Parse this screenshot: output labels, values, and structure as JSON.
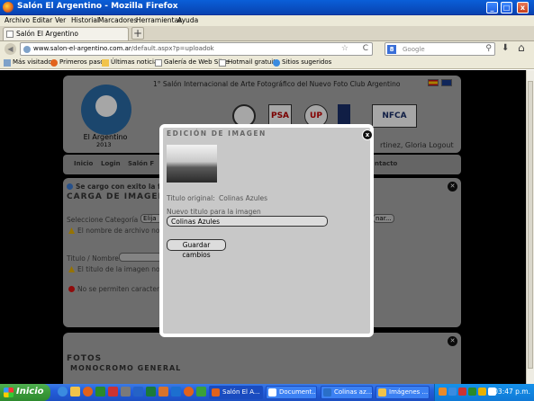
{
  "window": {
    "title": "Salón El Argentino - Mozilla Firefox",
    "minimize": "_",
    "maximize": "□",
    "close": "x"
  },
  "menu": [
    "Archivo",
    "Editar",
    "Ver",
    "Historial",
    "Marcadores",
    "Herramientas",
    "Ayuda"
  ],
  "tab": {
    "label": "Salón El Argentino",
    "new_tab": "+"
  },
  "nav": {
    "back": "◀",
    "url_domain": "www.salon-el-argentino.com.ar",
    "url_path": "/default.aspx?p=uploadok",
    "star": "☆",
    "reload": "C",
    "search_engine_label": "8",
    "search_placeholder": "Google",
    "download": "⬇",
    "home": "⌂"
  },
  "bookmarks": [
    "Más visitados",
    "Primeros pasos",
    "Últimas noticias",
    "Galería de Web Slice",
    "Hotmail gratuito",
    "Sitios sugeridos"
  ],
  "site": {
    "salon_title": "1° Salón Internacional de Arte Fotográfico del Nuevo Foto Club Argentino",
    "logo_name": "El Argentino",
    "logo_year": "2013",
    "emblems": [
      "",
      "PSA",
      "UP",
      "",
      "NFCA"
    ],
    "user_name": "rtinez, Gloria Logout",
    "nav_items": [
      "Inicio",
      "Login",
      "Salón F",
      "ntacto"
    ],
    "upload": {
      "success_note": "Se cargo con exito la f",
      "heading": "CARGA DE IMAGEN",
      "category_label": "Seleccione Categoría",
      "category_value": "Elija",
      "browse_label": "nar...",
      "warn_filename": "El nombre de archivo no pue",
      "title_label": "Titulo / Nombre",
      "warn_title": "El titulo de la imagen no pue",
      "err_chars": "No se permiten caracteres"
    },
    "fotos": {
      "heading": "FOTOS",
      "subheading": "MONOCROMO GENERAL"
    }
  },
  "modal": {
    "title": "EDICIÓN DE IMAGEN",
    "close": "x",
    "original_label": "Titulo original:",
    "original_value": "Colinas Azules",
    "new_title_label": "Nuevo titulo para la imagen",
    "new_title_value": "Colinas Azules",
    "save_button": "Guardar cambios"
  },
  "taskbar": {
    "start": "Inicio",
    "buttons": [
      "Salón El A...",
      "Document...",
      "Colinas az...",
      "Imágenes ..."
    ],
    "time": "03:47 p.m."
  }
}
